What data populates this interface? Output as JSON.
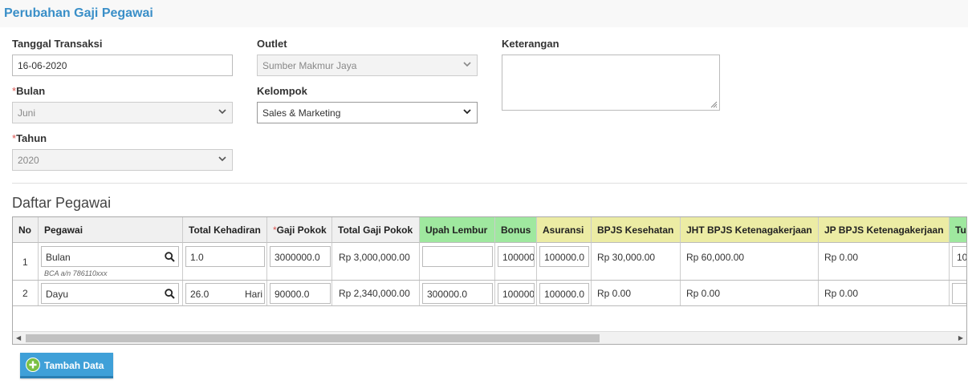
{
  "page": {
    "title": "Perubahan Gaji Pegawai"
  },
  "form": {
    "tanggal": {
      "label": "Tanggal Transaksi",
      "value": "16-06-2020"
    },
    "outlet": {
      "label": "Outlet",
      "value": "Sumber Makmur Jaya"
    },
    "keterangan": {
      "label": "Keterangan",
      "value": ""
    },
    "bulan": {
      "required": "*",
      "label": "Bulan",
      "value": "Juni"
    },
    "kelompok": {
      "label": "Kelompok",
      "value": "Sales & Marketing"
    },
    "tahun": {
      "required": "*",
      "label": "Tahun",
      "value": "2020"
    }
  },
  "table": {
    "section_title": "Daftar Pegawai",
    "headers": {
      "no": "No",
      "pegawai": "Pegawai",
      "kehadiran": "Total Kehadiran",
      "gaji_req": "*",
      "gaji": "Gaji Pokok",
      "total_gaji": "Total Gaji Pokok",
      "upah_lembur": "Upah Lembur",
      "bonus": "Bonus",
      "asuransi": "Asuransi",
      "bpjs_kes": "BPJS Kesehatan",
      "jht": "JHT BPJS Ketenagakerjaan",
      "jp": "JP BPJS Ketenagakerjaan",
      "next": "Tu"
    },
    "rows": [
      {
        "no": "1",
        "pegawai": "Bulan",
        "bank": "BCA a/n 786110xxx",
        "kehadiran": "1.0",
        "unit": "",
        "gaji": "3000000.0",
        "total_gaji": "Rp 3,000,000.00",
        "upah_lembur": "",
        "bonus": "100000",
        "asuransi": "100000.0",
        "bpjs_kes": "Rp 30,000.00",
        "jht": "Rp 60,000.00",
        "jp": "Rp 0.00",
        "next": "10"
      },
      {
        "no": "2",
        "pegawai": "Dayu",
        "bank": "",
        "kehadiran": "26.0",
        "unit": "Hari",
        "gaji": "90000.0",
        "total_gaji": "Rp 2,340,000.00",
        "upah_lembur": "300000.0",
        "bonus": "100000",
        "asuransi": "100000.0",
        "bpjs_kes": "Rp 0.00",
        "jht": "Rp 0.00",
        "jp": "Rp 0.00",
        "next": ""
      }
    ]
  },
  "actions": {
    "add_label": "Tambah Data"
  },
  "icons": {
    "search": "magnifier-icon",
    "dropdown": "chevron-down-icon",
    "add": "plus-circle-icon"
  },
  "colors": {
    "title": "#3a8fc8",
    "header_green": "#9fe89f",
    "header_yellow": "#ececa4",
    "button": "#3fa0d8"
  }
}
